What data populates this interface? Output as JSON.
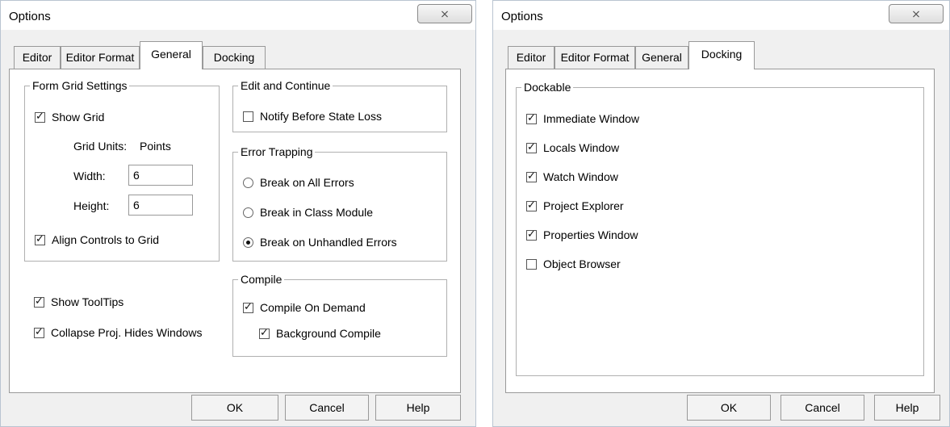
{
  "general_dialog": {
    "title": "Options",
    "close_glyph": "⨯",
    "tabs": [
      {
        "label": "Editor"
      },
      {
        "label": "Editor Format"
      },
      {
        "label": "General",
        "active": true
      },
      {
        "label": "Docking"
      }
    ],
    "form_grid": {
      "title": "Form Grid Settings",
      "show_grid": {
        "label": "Show Grid",
        "checked": true
      },
      "grid_units_label": "Grid Units:",
      "grid_units_value": "Points",
      "width_label": "Width:",
      "width_value": "6",
      "height_label": "Height:",
      "height_value": "6",
      "align_controls": {
        "label": "Align Controls to Grid",
        "checked": true
      }
    },
    "show_tooltips": {
      "label": "Show ToolTips",
      "checked": true
    },
    "collapse_proj": {
      "label": "Collapse Proj. Hides Windows",
      "checked": true
    },
    "edit_continue": {
      "title": "Edit and Continue",
      "notify": {
        "label": "Notify Before State Loss",
        "checked": false
      }
    },
    "error_trapping": {
      "title": "Error Trapping",
      "options": [
        {
          "label": "Break on All Errors",
          "selected": false
        },
        {
          "label": "Break in Class Module",
          "selected": false
        },
        {
          "label": "Break on Unhandled Errors",
          "selected": true
        }
      ]
    },
    "compile": {
      "title": "Compile",
      "on_demand": {
        "label": "Compile On Demand",
        "checked": true
      },
      "background": {
        "label": "Background Compile",
        "checked": true
      }
    },
    "buttons": {
      "ok": "OK",
      "cancel": "Cancel",
      "help": "Help"
    }
  },
  "docking_dialog": {
    "title": "Options",
    "close_glyph": "⨯",
    "tabs": [
      {
        "label": "Editor"
      },
      {
        "label": "Editor Format"
      },
      {
        "label": "General"
      },
      {
        "label": "Docking",
        "active": true
      }
    ],
    "dockable": {
      "title": "Dockable",
      "items": [
        {
          "label": "Immediate Window",
          "checked": true
        },
        {
          "label": "Locals Window",
          "checked": true
        },
        {
          "label": "Watch Window",
          "checked": true
        },
        {
          "label": "Project Explorer",
          "checked": true
        },
        {
          "label": "Properties Window",
          "checked": true
        },
        {
          "label": "Object Browser",
          "checked": false
        }
      ]
    },
    "buttons": {
      "ok": "OK",
      "cancel": "Cancel",
      "help": "Help"
    }
  }
}
